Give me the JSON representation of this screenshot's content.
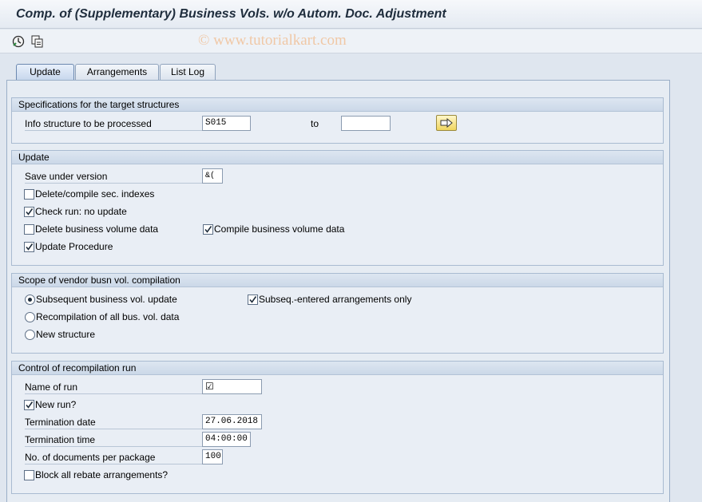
{
  "window": {
    "title": "Comp. of (Supplementary) Business Vols. w/o Autom. Doc. Adjustment"
  },
  "toolbar": {
    "execute_icon": "execute-icon",
    "variants_icon": "get-variant-icon"
  },
  "watermark": "© www.tutorialkart.com",
  "tabs": [
    {
      "label": "Update",
      "active": true
    },
    {
      "label": "Arrangements",
      "active": false
    },
    {
      "label": "List Log",
      "active": false
    }
  ],
  "spec": {
    "header": "Specifications for the target structures",
    "info_label": "Info structure to be processed",
    "info_value": "S015",
    "to_label": "to",
    "to_value": "",
    "multi_icon": "multiple-selection-arrow-icon"
  },
  "update": {
    "header": "Update",
    "version_label": "Save under version",
    "version_value": "&(",
    "delete_indexes": {
      "label": "Delete/compile sec. indexes",
      "checked": false
    },
    "check_run": {
      "label": "Check run: no update",
      "checked": true
    },
    "delete_bv": {
      "label": "Delete business volume data",
      "checked": false
    },
    "compile_bv": {
      "label": "Compile business volume data",
      "checked": true
    },
    "update_proc": {
      "label": "Update Procedure",
      "checked": true
    }
  },
  "scope": {
    "header": "Scope of vendor busn vol. compilation",
    "subsequent": {
      "label": "Subsequent business vol. update",
      "selected": true
    },
    "recompile": {
      "label": "Recompilation of all bus. vol. data",
      "selected": false
    },
    "new_structure": {
      "label": "New structure",
      "selected": false
    },
    "subseq_only": {
      "label": "Subseq.-entered arrangements only",
      "checked": true
    }
  },
  "control": {
    "header": "Control of recompilation run",
    "run_name_label": "Name of run",
    "run_name_value": "☑",
    "new_run": {
      "label": "New run?",
      "checked": true
    },
    "term_date_label": "Termination date",
    "term_date_value": "27.06.2018",
    "term_time_label": "Termination time",
    "term_time_value": "04:00:00",
    "docs_label": "No. of documents per package",
    "docs_value": "100",
    "block_all": {
      "label": "Block all rebate arrangements?",
      "checked": false
    }
  }
}
